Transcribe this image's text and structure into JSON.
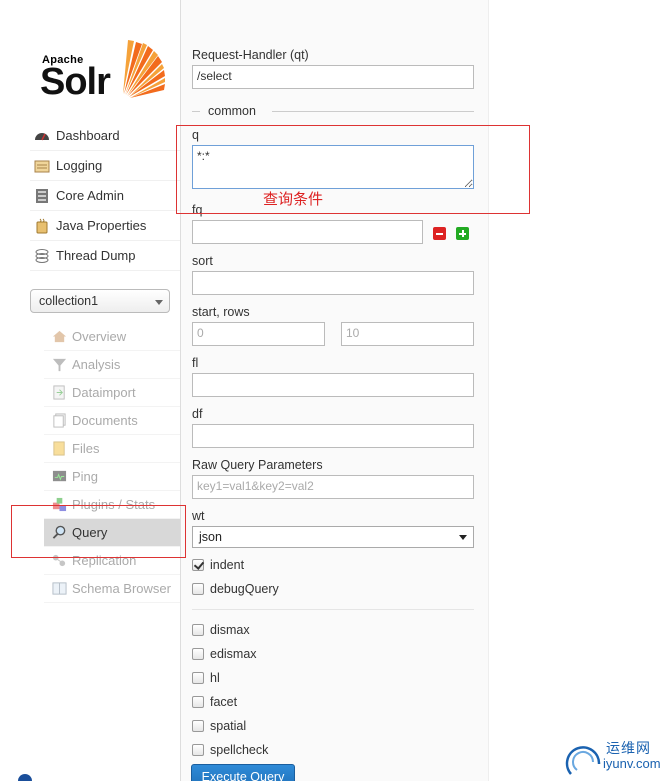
{
  "logo": {
    "top_text": "Apache",
    "main_text": "Solr"
  },
  "nav_main": [
    {
      "label": "Dashboard",
      "icon": "dashboard-icon"
    },
    {
      "label": "Logging",
      "icon": "logging-icon"
    },
    {
      "label": "Core Admin",
      "icon": "core-admin-icon"
    },
    {
      "label": "Java Properties",
      "icon": "java-properties-icon"
    },
    {
      "label": "Thread Dump",
      "icon": "thread-dump-icon"
    }
  ],
  "core_selector": {
    "value": "collection1"
  },
  "nav_core": [
    {
      "label": "Overview",
      "icon": "home-icon"
    },
    {
      "label": "Analysis",
      "icon": "funnel-icon"
    },
    {
      "label": "Dataimport",
      "icon": "dataimport-icon"
    },
    {
      "label": "Documents",
      "icon": "documents-icon"
    },
    {
      "label": "Files",
      "icon": "folder-icon"
    },
    {
      "label": "Ping",
      "icon": "ping-icon"
    },
    {
      "label": "Plugins / Stats",
      "icon": "plugins-icon"
    },
    {
      "label": "Query",
      "icon": "magnifier-icon"
    },
    {
      "label": "Replication",
      "icon": "replication-icon"
    },
    {
      "label": "Schema Browser",
      "icon": "schema-browser-icon"
    }
  ],
  "form": {
    "request_handler": {
      "label": "Request-Handler (qt)",
      "value": "/select"
    },
    "common_legend": "common",
    "q": {
      "label": "q",
      "value": "*:*"
    },
    "fq": {
      "label": "fq",
      "value": ""
    },
    "sort": {
      "label": "sort",
      "value": ""
    },
    "start_rows": {
      "label": "start, rows",
      "start_placeholder": "0",
      "rows_placeholder": "10"
    },
    "fl": {
      "label": "fl",
      "value": ""
    },
    "df": {
      "label": "df",
      "value": ""
    },
    "raw": {
      "label": "Raw Query Parameters",
      "placeholder": "key1=val1&key2=val2"
    },
    "wt": {
      "label": "wt",
      "value": "json"
    },
    "checkboxes_top": [
      {
        "label": "indent",
        "checked": true
      },
      {
        "label": "debugQuery",
        "checked": false
      }
    ],
    "checkboxes_bottom": [
      {
        "label": "dismax",
        "checked": false
      },
      {
        "label": "edismax",
        "checked": false
      },
      {
        "label": "hl",
        "checked": false
      },
      {
        "label": "facet",
        "checked": false
      },
      {
        "label": "spatial",
        "checked": false
      },
      {
        "label": "spellcheck",
        "checked": false
      }
    ],
    "execute_label": "Execute Query"
  },
  "annotation": {
    "text": "查询条件",
    "color": "#dd2222"
  },
  "watermark": {
    "line1": "运维网",
    "line2": "iyunv.com"
  }
}
